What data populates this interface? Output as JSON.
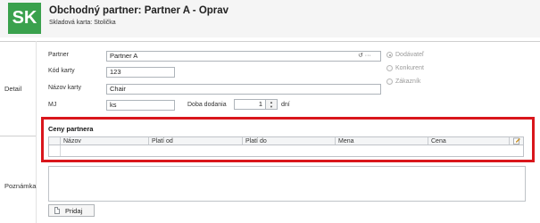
{
  "header": {
    "logo_text": "SK",
    "title": "Obchodný partner: Partner A - Oprav",
    "subtitle": "Skladová karta: Stolička",
    "logo_color": "#3aa14d"
  },
  "sections": {
    "detail": "Detail",
    "note": "Poznámka"
  },
  "form": {
    "partner_label": "Partner",
    "partner_value": "Partner A",
    "card_code_label": "Kód karty",
    "card_code_value": "123",
    "card_name_label": "Názov karty",
    "card_name_value": "Chair",
    "unit_label": "MJ",
    "unit_value": "ks",
    "delivery_label": "Doba dodania",
    "delivery_value": "1",
    "delivery_unit": "dní",
    "partner_actions": "↺ ···"
  },
  "partner_type": {
    "options": [
      "Dodávateľ",
      "Konkurent",
      "Zákazník"
    ],
    "selected": "Dodávateľ"
  },
  "price_grid": {
    "title": "Ceny partnera",
    "columns": [
      "Názov",
      "Platí od",
      "Platí do",
      "Mena",
      "Cena"
    ]
  },
  "buttons": {
    "add": "Pridaj"
  },
  "highlight_color": "#d9161c"
}
